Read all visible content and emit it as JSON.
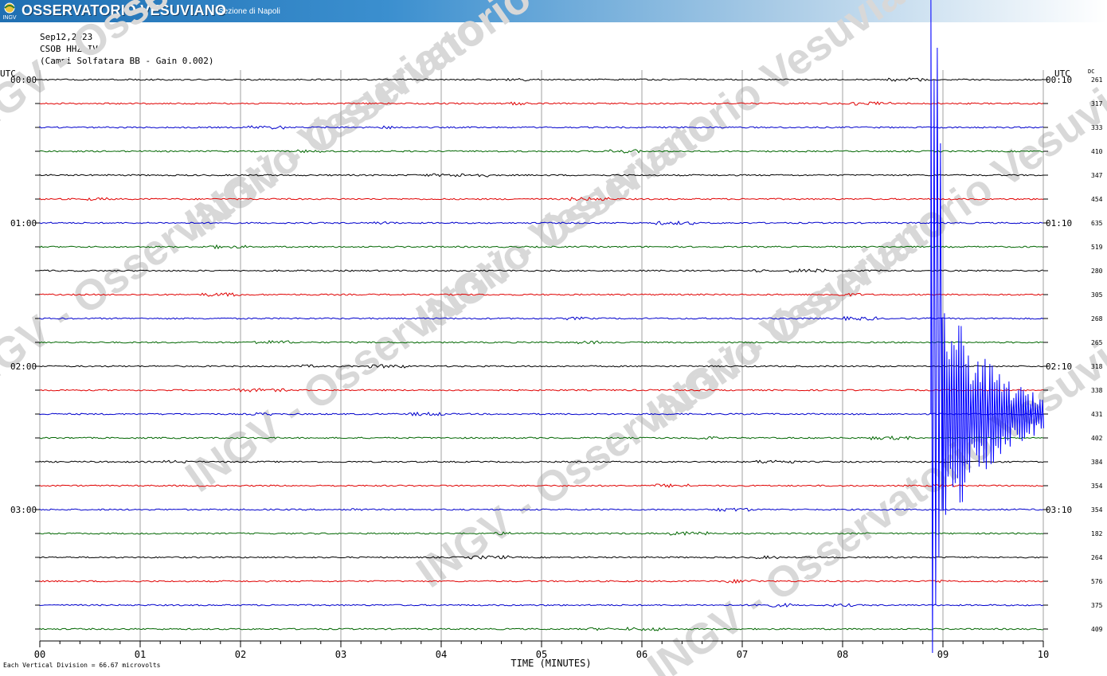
{
  "header": {
    "logo_text": "INGV",
    "org_name": "OSSERVATORIO VESUVIANO",
    "section": "Sezione di Napoli"
  },
  "info": {
    "date": "Sep12,2023",
    "station": "CSOB HHZ IV",
    "description": "(Campi Solfatara BB - Gain 0.002)"
  },
  "footer": {
    "scale_note": "Each Vertical Division =   66.67 microvolts",
    "xlabel": "TIME (MINUTES)"
  },
  "chart_data": {
    "type": "line",
    "title": "",
    "xlabel": "TIME (MINUTES)",
    "x_range": [
      0,
      10
    ],
    "x_ticks": [
      "00",
      "01",
      "02",
      "03",
      "04",
      "05",
      "06",
      "07",
      "08",
      "09",
      "10"
    ],
    "left_axis_label": "UTC",
    "right_axis_label": "UTC",
    "dc_label": "DC",
    "left_time_labels": [
      {
        "row": 0,
        "label": "00:00"
      },
      {
        "row": 6,
        "label": "01:00"
      },
      {
        "row": 12,
        "label": "02:00"
      },
      {
        "row": 18,
        "label": "03:00"
      }
    ],
    "right_time_labels": [
      {
        "row": 0,
        "label": "00:10"
      },
      {
        "row": 6,
        "label": "01:10"
      },
      {
        "row": 12,
        "label": "02:10"
      },
      {
        "row": 18,
        "label": "03:10"
      }
    ],
    "dc_values": [
      "261",
      "317",
      "333",
      "410",
      "347",
      "454",
      "635",
      "519",
      "280",
      "305",
      "268",
      "265",
      "318",
      "338",
      "431",
      "402",
      "384",
      "354",
      "354",
      "182",
      "264",
      "576",
      "375",
      "409"
    ],
    "trace_colors": [
      "#000000",
      "#e00000",
      "#0000cc",
      "#006600"
    ],
    "trace_count": 24,
    "minutes_per_trace": 10,
    "grid": true,
    "watermark": "INGV - Osservatorio Vesuviano",
    "events": [
      {
        "trace_row": 14,
        "onset_minute": 8.88,
        "coda_end_minute": 10,
        "color": "#0000ff",
        "description": "earthquake"
      }
    ]
  }
}
